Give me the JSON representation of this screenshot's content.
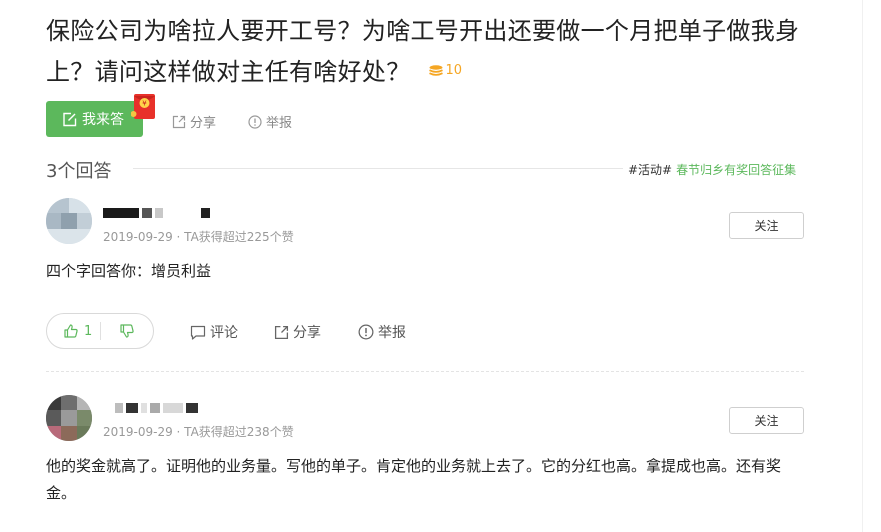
{
  "question": {
    "title": "保险公司为啥拉人要开工号？为啥工号开出还要做一个月把单子做我身上？请问这样做对主任有啥好处？",
    "reward": "10"
  },
  "toolbar": {
    "answer_label": "我来答",
    "share_label": "分享",
    "report_label": "举报"
  },
  "answers_header": {
    "count_label": "3个回答",
    "activity_tag": "#活动#",
    "activity_link": "春节归乡有奖回答征集"
  },
  "answers": [
    {
      "meta": "2019-09-29 · TA获得超过225个赞",
      "follow_label": "关注",
      "content": "四个字回答你：增员利益",
      "upvotes": "1",
      "comment_label": "评论",
      "share_label": "分享",
      "report_label": "举报"
    },
    {
      "meta": "2019-09-29 · TA获得超过238个赞",
      "follow_label": "关注",
      "content": "他的奖金就高了。证明他的业务量。写他的单子。肯定他的业务就上去了。它的分红也高。拿提成也高。还有奖金。"
    }
  ],
  "colors": {
    "accent_green": "#5cb85c",
    "coin_gold": "#f5a623",
    "redpacket": "#e8312a"
  }
}
